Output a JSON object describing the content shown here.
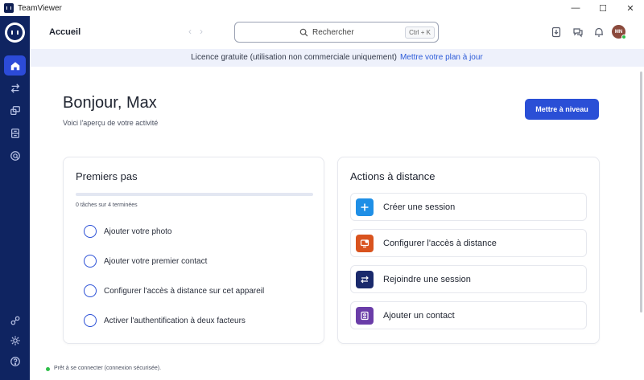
{
  "window": {
    "title": "TeamViewer",
    "controls": {
      "minimize": "—",
      "maximize": "☐",
      "close": "✕"
    }
  },
  "header": {
    "page_title": "Accueil",
    "back_arrow": "‹",
    "forward_arrow": "›",
    "search": {
      "placeholder": "Rechercher",
      "shortcut": "Ctrl + K"
    },
    "avatar_initials": "MN"
  },
  "banner": {
    "text": "Licence gratuite (utilisation non commerciale uniquement)",
    "link": "Mettre votre plan à jour"
  },
  "main": {
    "greeting": "Bonjour, Max",
    "subtitle": "Voici l'aperçu de votre activité",
    "upgrade_button": "Mettre à niveau"
  },
  "first_steps": {
    "title": "Premiers pas",
    "progress_text": "0 tâches sur 4 terminées",
    "progress_fraction": 0,
    "tasks": [
      "Ajouter votre photo",
      "Ajouter votre premier contact",
      "Configurer l'accès à distance sur cet appareil",
      "Activer l'authentification à deux facteurs"
    ]
  },
  "remote_actions": {
    "title": "Actions à distance",
    "items": [
      {
        "label": "Créer une session",
        "icon": "plus-icon",
        "color": "#1f8fe6"
      },
      {
        "label": "Configurer l'accès à distance",
        "icon": "remote-access-icon",
        "color": "#d9531e"
      },
      {
        "label": "Rejoindre une session",
        "icon": "arrows-swap-icon",
        "color": "#1a2a6c"
      },
      {
        "label": "Ajouter un contact",
        "icon": "contact-book-icon",
        "color": "#6a3da8"
      }
    ]
  },
  "status": {
    "text": "Prêt à se connecter (connexion sécurisée)."
  },
  "colors": {
    "sidebar": "#0f2461",
    "accent": "#2a4fd6",
    "banner_bg": "#eef1fb",
    "online": "#2fbf4a"
  }
}
